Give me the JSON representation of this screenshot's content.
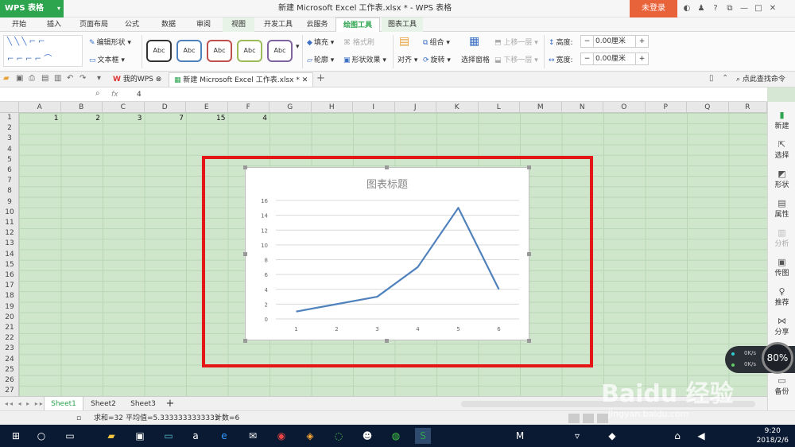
{
  "app": {
    "logo": "WPS 表格",
    "window_title": "新建 Microsoft Excel 工作表.xlsx * - WPS 表格",
    "login": "未登录"
  },
  "tabs": [
    "开始",
    "插入",
    "页面布局",
    "公式",
    "数据",
    "审阅",
    "视图",
    "开发工具",
    "云服务",
    "绘图工具",
    "图表工具"
  ],
  "ribbon": {
    "edit_shape": "编辑形状",
    "text_box": "文本框",
    "style_label": "Abc",
    "fill": "填充",
    "format_brush": "格式刷",
    "outline": "轮廓",
    "shape_effect": "形状效果",
    "align": "对齐",
    "group": "组合",
    "rotate": "旋转",
    "selection_pane": "选择窗格",
    "bring_forward": "上移一层",
    "send_backward": "下移一层",
    "height_label": "高度:",
    "height_value": "0.00厘米",
    "width_label": "宽度:",
    "width_value": "0.00厘米"
  },
  "doc_tabs": {
    "my_wps": "我的WPS",
    "active_doc": "新建 Microsoft Excel 工作表.xlsx *",
    "find_command": "点此查找命令"
  },
  "formula_bar": {
    "fx": "fx",
    "value": "4"
  },
  "columns": [
    "A",
    "B",
    "C",
    "D",
    "E",
    "F",
    "G",
    "H",
    "I",
    "J",
    "K",
    "L",
    "M",
    "N",
    "O",
    "P",
    "Q",
    "R"
  ],
  "rows": [
    "1",
    "2",
    "3",
    "4",
    "5",
    "6",
    "7",
    "8",
    "9",
    "10",
    "11",
    "12",
    "13",
    "14",
    "15",
    "16",
    "17",
    "18",
    "19",
    "20",
    "21",
    "22",
    "23",
    "24",
    "25",
    "26",
    "27"
  ],
  "row1_values": [
    "1",
    "2",
    "3",
    "7",
    "15",
    "4"
  ],
  "chart_data": {
    "type": "line",
    "title": "图表标题",
    "categories": [
      "1",
      "2",
      "3",
      "4",
      "5",
      "6"
    ],
    "series": [
      {
        "values": [
          1,
          2,
          3,
          7,
          15,
          4
        ]
      }
    ],
    "ylim": [
      0,
      16
    ],
    "yticks": [
      "0",
      "2",
      "4",
      "6",
      "8",
      "10",
      "12",
      "14",
      "16"
    ],
    "grid": true,
    "line_color": "#4f81bd"
  },
  "sidebar": [
    {
      "label": "新建",
      "icon": "new-doc-icon",
      "enabled": true
    },
    {
      "label": "选择",
      "icon": "select-icon",
      "enabled": true
    },
    {
      "label": "形状",
      "icon": "shapes-icon",
      "enabled": true
    },
    {
      "label": "属性",
      "icon": "properties-icon",
      "enabled": true
    },
    {
      "label": "分析",
      "icon": "analysis-icon",
      "enabled": false
    },
    {
      "label": "传图",
      "icon": "upload-image-icon",
      "enabled": true
    },
    {
      "label": "推荐",
      "icon": "recommend-icon",
      "enabled": true
    },
    {
      "label": "分享",
      "icon": "share-icon",
      "enabled": true
    },
    {
      "label": "备份",
      "icon": "backup-icon",
      "enabled": true
    }
  ],
  "speed_widget": {
    "up": "0K/s",
    "down": "0K/s",
    "percent": "80%"
  },
  "sheets": [
    "Sheet1",
    "Sheet2",
    "Sheet3"
  ],
  "status": {
    "sum": "求和=32",
    "average": "平均值=5.3333333333333",
    "count": "计数=6"
  },
  "taskbar": {
    "time": "9:20",
    "date": "2018/2/6"
  },
  "watermark": {
    "text": "Baidu 经验",
    "url": "jingyan.baidu.com"
  },
  "colors": {
    "accent": "#2da44e",
    "login": "#e8623a",
    "highlight_box": "#e51616",
    "style_borders": [
      "#333333",
      "#4f81bd",
      "#c0504d",
      "#9bbb59",
      "#8064a2"
    ]
  }
}
